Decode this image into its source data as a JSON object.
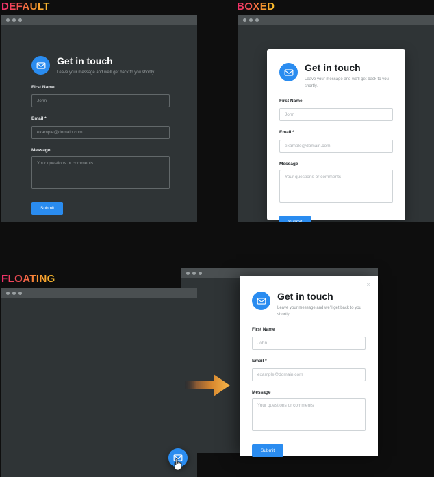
{
  "page": {
    "background": "#0e0e0e",
    "accent": "#2a8cf0",
    "label_gradient_from": "#ef2d6b",
    "label_gradient_to": "#fbc02d"
  },
  "sections": {
    "default": {
      "label": "DEFAULT"
    },
    "boxed": {
      "label": "BOXED"
    },
    "floating": {
      "label": "FLOATING"
    }
  },
  "form": {
    "title": "Get in touch",
    "subtitle": "Leave your message and we'll get back to you shortly.",
    "avatar_icon": "envelope-icon",
    "fields": {
      "first_name": {
        "label": "First Name",
        "placeholder": "John",
        "value": ""
      },
      "email": {
        "label": "Email *",
        "placeholder": "example@domain.com",
        "value": ""
      },
      "message": {
        "label": "Message",
        "placeholder": "Your questions or comments",
        "value": ""
      }
    },
    "submit_label": "Submit"
  },
  "floating": {
    "fab_icon": "envelope-icon",
    "close_label": "×",
    "cursor_icon": "pointer-hand-cursor",
    "arrow_icon": "right-arrow-icon"
  },
  "window_controls": {
    "dots": 3
  }
}
